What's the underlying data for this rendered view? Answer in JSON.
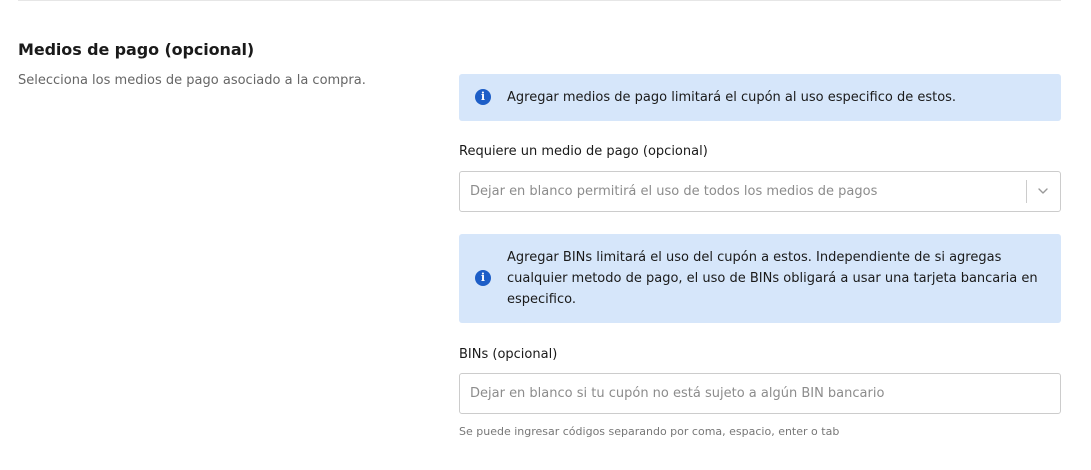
{
  "section": {
    "title": "Medios de pago (opcional)",
    "description": "Selecciona los medios de pago asociado a la compra."
  },
  "info_payment": {
    "icon": "info-icon",
    "text": "Agregar medios de pago limitará el cupón al uso especifico de estos."
  },
  "payment_method": {
    "label": "Requiere un medio de pago (opcional)",
    "placeholder": "Dejar en blanco permitirá el uso de todos los medios de pagos",
    "icon": "chevron-down-icon"
  },
  "info_bins": {
    "icon": "info-icon",
    "text": "Agregar BINs limitará el uso del cupón a estos. Independiente de si agregas cualquier metodo de pago, el uso de BINs obligará a usar una tarjeta bancaria en especifico."
  },
  "bins": {
    "label": "BINs (opcional)",
    "placeholder": "Dejar en blanco si tu cupón no está sujeto a algún BIN bancario",
    "helper": "Se puede ingresar códigos separando por coma, espacio, enter o tab"
  },
  "colors": {
    "info_background": "#d6e6fa",
    "info_icon": "#1d5ec7",
    "border": "#cccccc",
    "placeholder": "#8c8c8c"
  }
}
